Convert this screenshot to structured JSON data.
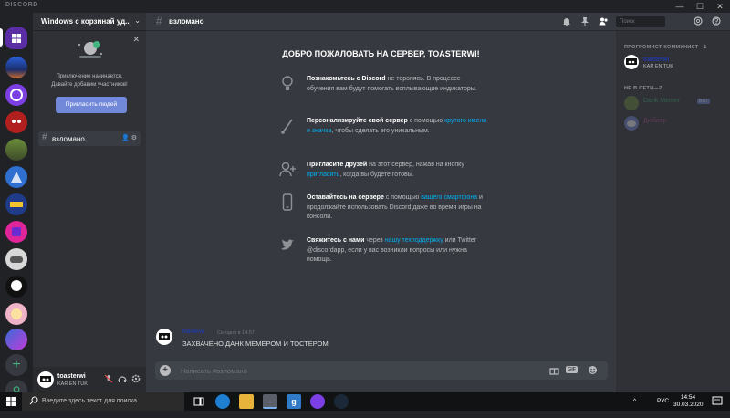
{
  "window": {
    "brand": "DISCORD",
    "minimize": "—",
    "maximize": "☐",
    "close": "✕"
  },
  "rail": {
    "add_label": "+",
    "explore_label": "⚲"
  },
  "server": {
    "name": "Windows с корзинай уд...",
    "chevron": "⌄"
  },
  "invite": {
    "close": "✕",
    "text_line1": "Приключение начинается.",
    "text_line2": "Давайте добавим участников!",
    "button": "Пригласить людей"
  },
  "channels": [
    {
      "hash": "#",
      "name": "взломано",
      "icons": "👤 ⚙"
    }
  ],
  "user": {
    "name": "toasterwi",
    "status": "KAR EN TUK"
  },
  "topbar": {
    "hash": "#",
    "channel": "взломано",
    "search_placeholder": "Поиск"
  },
  "welcome": {
    "title": "ДОБРО ПОЖАЛОВАТЬ НА СЕРВЕР, TOASTERWI!",
    "tips": [
      {
        "icon": "bulb-icon",
        "bold": "Познакомьтесь с Discord",
        "text": " не торопясь. В процессе обучения вам будут помогать всплывающие индикаторы.",
        "link": "",
        "after": ""
      },
      {
        "icon": "brush-icon",
        "bold": "Персонализируйте свой сервер",
        "text": " с помощью ",
        "link": "крутого имени и значка",
        "after": ", чтобы сделать его уникальным."
      },
      {
        "icon": "add-friend-icon",
        "bold": "Пригласите друзей",
        "text": " на этот сервер, нажав на кнопку ",
        "link": "пригласить",
        "after": ", когда вы будете готовы."
      },
      {
        "icon": "phone-icon",
        "bold": "Оставайтесь на сервере",
        "text": " с помощью ",
        "link": "вашего смартфона",
        "after": " и продолжайте использовать Discord даже во время игры на консоли."
      },
      {
        "icon": "twitter-icon",
        "bold": "Свяжитесь с нами",
        "text": " через ",
        "link": "нашу техподдержку",
        "after": " или Twitter @discordapp, если у вас возникли вопросы или нужна помощь."
      }
    ]
  },
  "message": {
    "author": "toasterwi",
    "time": "Сегодня в 14:57",
    "text": "ЗАХВАЧЕНО ДАНК МЕМЕРОМ И ТОСТЕРОМ"
  },
  "composer": {
    "plus": "+",
    "placeholder": "Написать #взломано",
    "gif": "GIF"
  },
  "members": {
    "online_header": "ПРОГРОМИСТ КОММУНИСТ—1",
    "offline_header": "НЕ В СЕТИ—2",
    "online": [
      {
        "name": "toasterwi",
        "sub": "KAR EN TUK",
        "color": "#1a3bd6"
      }
    ],
    "offline": [
      {
        "name": "Dank Memer",
        "bot": "BOT",
        "color": "#43b581"
      },
      {
        "name": "Дюбаер",
        "color": "#b5478a"
      }
    ]
  },
  "taskbar": {
    "search_text": "Введите здесь текст для поиска",
    "lang": "РУС",
    "time": "14:54",
    "date": "30.03.2020",
    "tray_up": "^"
  }
}
